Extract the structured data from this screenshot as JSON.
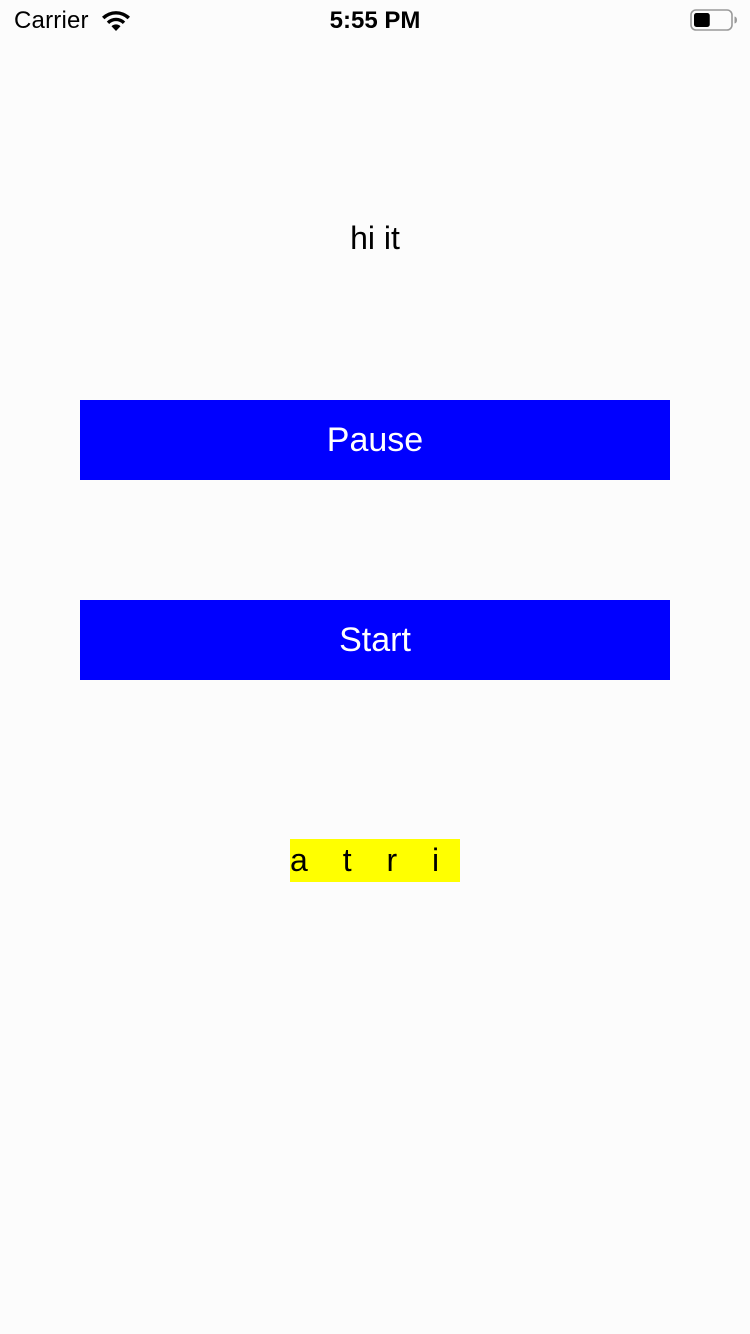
{
  "status_bar": {
    "carrier": "Carrier",
    "time": "5:55 PM",
    "wifi_icon": "wifi-icon",
    "battery_icon": "battery-icon",
    "battery_level": 0.45
  },
  "main": {
    "title_label": "hi it",
    "pause_button": "Pause",
    "start_button": "Start",
    "attributed_label": "a t r i b ",
    "button_color": "#0000ff",
    "attributed_background": "#ffff00"
  }
}
